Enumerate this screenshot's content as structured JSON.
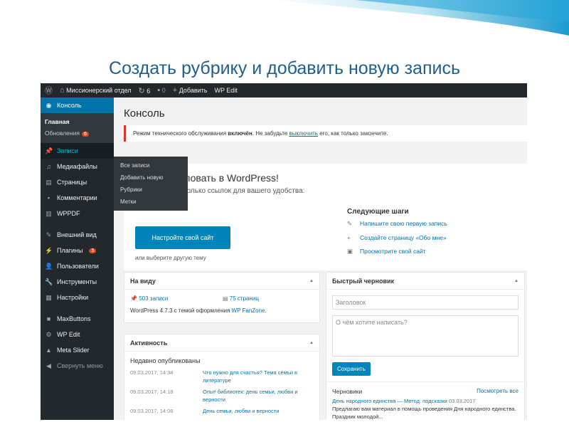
{
  "slide_title": "Создать рубрику и добавить новую запись",
  "adminbar": {
    "site": "Миссионерский отдел",
    "updates": "6",
    "comments": "0",
    "add": "Добавить",
    "wpedit": "WP Edit"
  },
  "sidebar": {
    "console": "Консоль",
    "home": "Главная",
    "updates": "Обновления",
    "updates_badge": "6",
    "items": [
      {
        "label": "Записи"
      },
      {
        "label": "Медиафайлы"
      },
      {
        "label": "Страницы"
      },
      {
        "label": "Комментарии"
      },
      {
        "label": "WPPDF"
      },
      {
        "label": "Внешний вид"
      },
      {
        "label": "Плагины",
        "badge": "5"
      },
      {
        "label": "Пользователи"
      },
      {
        "label": "Инструменты"
      },
      {
        "label": "Настройки"
      },
      {
        "label": "MaxButtons"
      },
      {
        "label": "WP Edit"
      },
      {
        "label": "Meta Slider"
      },
      {
        "label": "Свернуть меню"
      }
    ]
  },
  "flyout": [
    "Все записи",
    "Добавить новую",
    "Рубрики",
    "Метки"
  ],
  "main": {
    "title": "Консоль",
    "notice": {
      "pre": "Режим технического обслуживания ",
      "bold": "включён",
      "mid": ". Не забудьте ",
      "link": "выключить",
      "post": " его, как только закончите."
    },
    "welcome": {
      "title": "Добро пожаловать в WordPress!",
      "subtitle": "Мы собрали несколько ссылок для вашего удобства:",
      "button": "Настройте свой сайт",
      "other": "или выберите другую тему",
      "next_title": "Следующие шаги",
      "next": [
        "Напишите свою первую запись",
        "Создайте страницу «Обо мне»",
        "Просмотрите свой сайт"
      ]
    },
    "glance": {
      "title": "На виду",
      "posts": "503 записи",
      "pages": "75 страниц",
      "version_pre": "WordPress 4.7.3 с темой оформления ",
      "theme": "WP FanZone",
      "version_post": "."
    },
    "activity": {
      "title": "Активность",
      "recent": "Недавно опубликованы",
      "rows": [
        {
          "date": "09.03.2017, 14:34",
          "title": "Что нужно для счастья? Тема семьи в литературе"
        },
        {
          "date": "09.03.2017, 14:18",
          "title": "Опыт библиотек: день семьи, любви и верности"
        },
        {
          "date": "09.03.2017, 14:06",
          "title": "День семьи, любви и верности"
        }
      ]
    },
    "draft": {
      "title": "Быстрый черновик",
      "title_placeholder": "Заголовок",
      "content_placeholder": "О чём хотите написать?",
      "save": "Сохранить",
      "drafts": "Черновики",
      "view_all": "Посмотреть все",
      "item_title": "День народного единства — Метод. подсказки",
      "item_date": "03.03.2017",
      "item_excerpt": "Предлагаю вам  материал в помощь проведения  Дня народного единства. Праздник молодой..."
    }
  }
}
